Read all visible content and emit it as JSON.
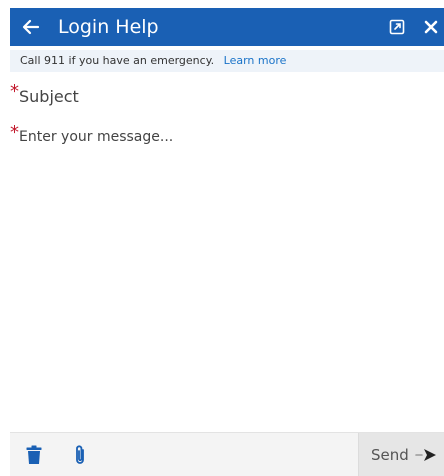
{
  "header": {
    "title": "Login Help",
    "back_icon": "arrow-left-icon",
    "popout_icon": "popout-icon",
    "close_icon": "close-icon",
    "background_color": "#1a60b4"
  },
  "notice": {
    "text": "Call 911 if you have an emergency.",
    "link_text": "Learn more"
  },
  "form": {
    "required_marker": "*",
    "subject_placeholder": "Subject",
    "message_placeholder": "Enter your message..."
  },
  "footer": {
    "trash_icon": "trash-icon",
    "attach_icon": "paperclip-icon",
    "send_label": "Send",
    "send_icon": "send-arrow-icon",
    "icon_color": "#1a60b4"
  }
}
